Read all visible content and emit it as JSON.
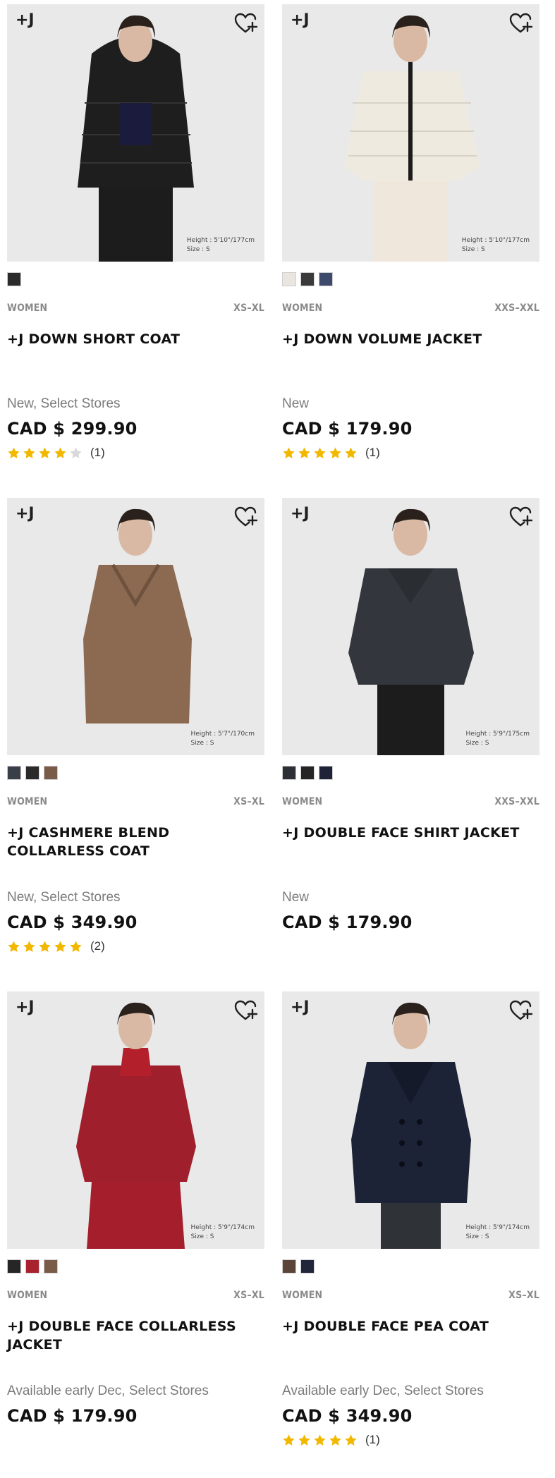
{
  "products": [
    {
      "brand_mark": "+J",
      "model_info": [
        "Height : 5'10\"/177cm",
        "Size : S"
      ],
      "colors": [
        "#2b2b2b"
      ],
      "gender": "WOMEN",
      "size_range": "XS–XL",
      "name": "+J DOWN SHORT COAT",
      "flag": "New, Select Stores",
      "price": "CAD $ 299.90",
      "rating": 4,
      "review_count": "(1)",
      "garment_color": "#1e1e1e",
      "figure": "hooded-puffer"
    },
    {
      "brand_mark": "+J",
      "model_info": [
        "Height : 5'10\"/177cm",
        "Size : S"
      ],
      "colors": [
        "#ebe5df",
        "#3a3a3a",
        "#3d4a6b"
      ],
      "gender": "WOMEN",
      "size_range": "XXS–XXL",
      "name": "+J DOWN VOLUME JACKET",
      "flag": "New",
      "price": "CAD $ 179.90",
      "rating": 5,
      "review_count": "(1)",
      "garment_color": "#efeae0",
      "figure": "puffer"
    },
    {
      "brand_mark": "+J",
      "model_info": [
        "Height : 5'7\"/170cm",
        "Size : S"
      ],
      "colors": [
        "#3a3e48",
        "#2a2a2a",
        "#7a5a48"
      ],
      "gender": "WOMEN",
      "size_range": "XS–XL",
      "name": "+J CASHMERE BLEND COLLARLESS COAT",
      "flag": "New, Select Stores",
      "price": "CAD $ 349.90",
      "rating": 5,
      "review_count": "(2)",
      "garment_color": "#8c6a52",
      "figure": "long-coat"
    },
    {
      "brand_mark": "+J",
      "model_info": [
        "Height : 5'9\"/175cm",
        "Size : S"
      ],
      "colors": [
        "#2c2f36",
        "#252525",
        "#1f2338"
      ],
      "gender": "WOMEN",
      "size_range": "XXS–XXL",
      "name": "+J DOUBLE FACE SHIRT JACKET",
      "flag": "New",
      "price": "CAD $ 179.90",
      "rating": null,
      "review_count": "",
      "garment_color": "#33373d",
      "figure": "short-jacket"
    },
    {
      "brand_mark": "+J",
      "model_info": [
        "Height : 5'9\"/174cm",
        "Size : S"
      ],
      "colors": [
        "#262626",
        "#a8222e",
        "#7a5a48"
      ],
      "gender": "WOMEN",
      "size_range": "XS–XL",
      "name": "+J DOUBLE FACE COLLARLESS JACKET",
      "flag": "Available early Dec, Select Stores",
      "price": "CAD $ 179.90",
      "rating": null,
      "review_count": "",
      "garment_color": "#a01f2d",
      "figure": "short-jacket-skirt"
    },
    {
      "brand_mark": "+J",
      "model_info": [
        "Height : 5'9\"/174cm",
        "Size : S"
      ],
      "colors": [
        "#5a4538",
        "#22263a"
      ],
      "gender": "WOMEN",
      "size_range": "XS–XL",
      "name": "+J DOUBLE FACE PEA COAT",
      "flag": "Available early Dec, Select Stores",
      "price": "CAD $ 349.90",
      "rating": 5,
      "review_count": "(1)",
      "garment_color": "#1d2337",
      "figure": "pea-coat"
    }
  ],
  "accent": {
    "star_on": "#f2b800",
    "star_off": "#d9d9d9"
  }
}
